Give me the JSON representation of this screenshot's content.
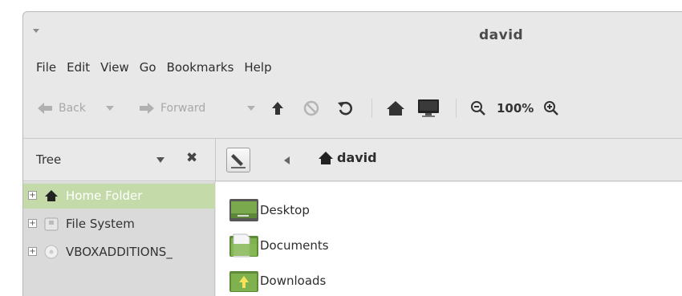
{
  "window": {
    "title": "david"
  },
  "menu": [
    "File",
    "Edit",
    "View",
    "Go",
    "Bookmarks",
    "Help"
  ],
  "toolbar": {
    "back_label": "Back",
    "forward_label": "Forward",
    "zoom": "100%"
  },
  "side_pane": {
    "title": "Tree"
  },
  "location": {
    "current": "david"
  },
  "tree": [
    {
      "label": "Home Folder",
      "selected": true,
      "icon": "home-icon"
    },
    {
      "label": "File System",
      "selected": false,
      "icon": "drive-icon"
    },
    {
      "label": "VBOXADDITIONS_",
      "selected": false,
      "icon": "cdrom-icon"
    }
  ],
  "files": [
    {
      "name": "Desktop",
      "icon": "desktop-folder-icon"
    },
    {
      "name": "Documents",
      "icon": "documents-folder-icon"
    },
    {
      "name": "Downloads",
      "icon": "downloads-folder-icon"
    }
  ],
  "colors": {
    "selection": "#c4dba9",
    "accent_green": "#78a94b",
    "window_bg": "#e8e8e8"
  }
}
